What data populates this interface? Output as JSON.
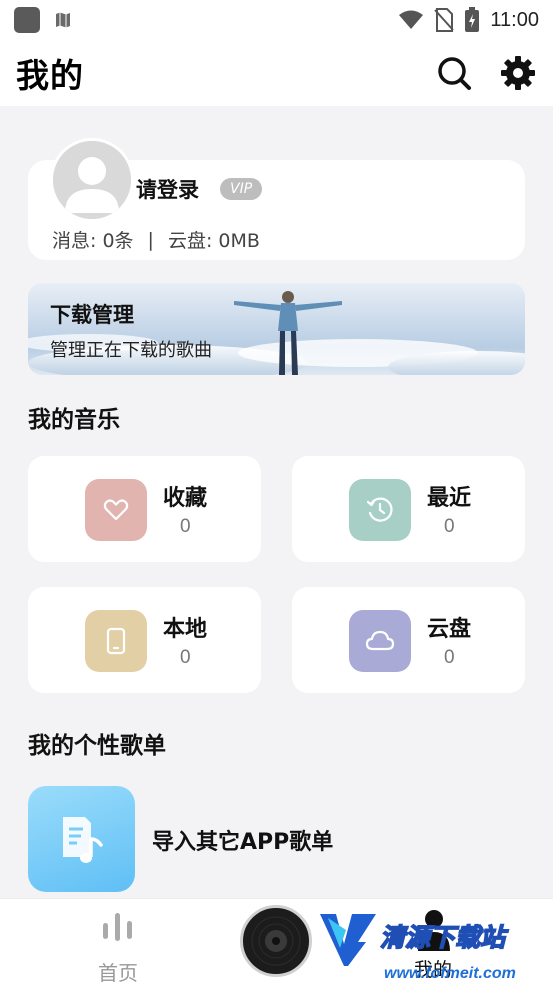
{
  "status_bar": {
    "time": "11:00"
  },
  "header": {
    "title": "我的"
  },
  "profile": {
    "login_label": "请登录",
    "vip_label": "VIP",
    "messages": "消息: 0条",
    "separator": "|",
    "cloud": "云盘: 0MB"
  },
  "download_banner": {
    "title": "下载管理",
    "subtitle": "管理正在下载的歌曲"
  },
  "my_music": {
    "title": "我的音乐",
    "tiles": [
      {
        "label": "收藏",
        "count": "0",
        "icon": "heart-icon",
        "color": "#e2b4b0"
      },
      {
        "label": "最近",
        "count": "0",
        "icon": "clock-icon",
        "color": "#a7cfc5"
      },
      {
        "label": "本地",
        "count": "0",
        "icon": "phone-icon",
        "color": "#e3cfa5"
      },
      {
        "label": "云盘",
        "count": "0",
        "icon": "cloud-icon",
        "color": "#a9aad6"
      }
    ]
  },
  "playlists": {
    "title": "我的个性歌单",
    "import_label": "导入其它APP歌单"
  },
  "bottom_nav": {
    "home_label": "首页",
    "mine_label": "我的"
  },
  "watermark": {
    "brand": "清源下载站",
    "url": "www.fofmeit.com"
  }
}
